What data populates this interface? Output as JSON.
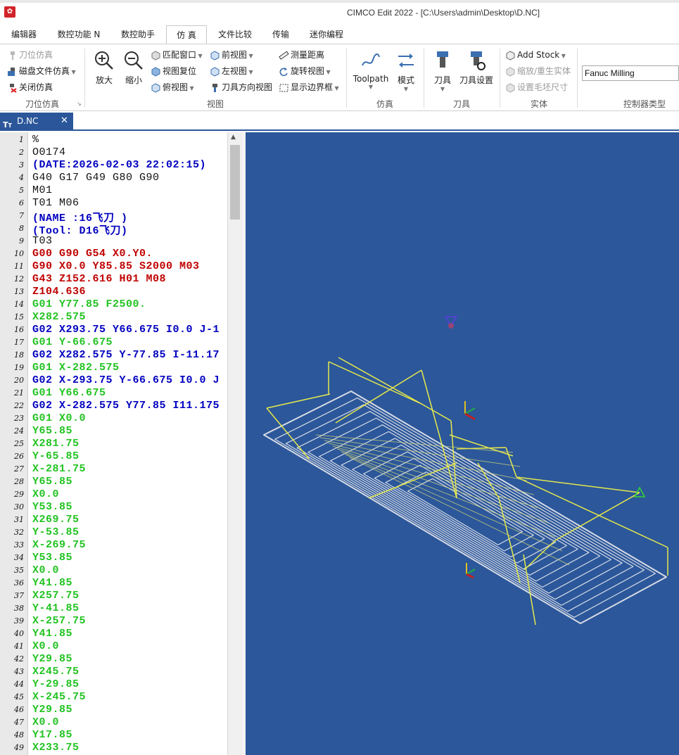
{
  "window": {
    "title": "CIMCO Edit 2022 - [C:\\Users\\admin\\Desktop\\D.NC]"
  },
  "menu": {
    "tabs": [
      {
        "label": "编辑器"
      },
      {
        "label": "数控功能 N"
      },
      {
        "label": "数控助手"
      },
      {
        "label": "仿 真"
      },
      {
        "label": "文件比较"
      },
      {
        "label": "传输"
      },
      {
        "label": "迷你编程"
      }
    ],
    "active_tab": "仿 真"
  },
  "ribbon": {
    "toolpath_sim": {
      "group_label": "刀位仿真",
      "items": [
        {
          "label": "刀位仿真",
          "icon": "tool-sim-icon",
          "enabled": false
        },
        {
          "label": "磁盘文件仿真",
          "icon": "disk-sim-icon",
          "enabled": true
        },
        {
          "label": "关闭仿真",
          "icon": "close-sim-icon",
          "enabled": true
        }
      ]
    },
    "view": {
      "group_label": "视图",
      "zoom_in": "放大",
      "zoom_out": "缩小",
      "items": [
        {
          "label": "匹配窗口",
          "icon": "fit-window-icon"
        },
        {
          "label": "视图复位",
          "icon": "view-reset-icon"
        },
        {
          "label": "俯视图",
          "icon": "top-view-icon"
        },
        {
          "label": "前视图",
          "icon": "front-view-icon"
        },
        {
          "label": "左视图",
          "icon": "left-view-icon"
        },
        {
          "label": "刀具方向视图",
          "icon": "tool-dir-view-icon"
        },
        {
          "label": "测量距离",
          "icon": "measure-icon"
        },
        {
          "label": "旋转视图",
          "icon": "rotate-view-icon"
        },
        {
          "label": "显示边界框",
          "icon": "bounding-box-icon"
        }
      ]
    },
    "simulation": {
      "group_label": "仿真",
      "toolpath": "Toolpath",
      "mode": "模式"
    },
    "tool": {
      "group_label": "刀具",
      "tool": "刀具",
      "tool_settings": "刀具设置"
    },
    "solid": {
      "group_label": "实体",
      "items": [
        {
          "label": "Add Stock",
          "enabled": true
        },
        {
          "label": "缩放/重生实体",
          "enabled": false
        },
        {
          "label": "设置毛坯尺寸",
          "enabled": false
        }
      ]
    },
    "controller": {
      "group_label": "控制器类型",
      "value": "Fanuc Milling"
    }
  },
  "document_tab": {
    "label": "D.NC"
  },
  "colors": {
    "accent": "#2b579a",
    "viewport_bg": "#2c579a",
    "code_black": "#111111",
    "code_blue": "#0000c0",
    "code_red": "#c00000",
    "code_green": "#22c322",
    "toolpath_yellow": "#e5e84c",
    "stock_outline": "#d6dbe6"
  },
  "code_lines": [
    {
      "n": "1",
      "text": "%",
      "color": "black"
    },
    {
      "n": "2",
      "text": "O0174",
      "color": "black"
    },
    {
      "n": "3",
      "text": "(DATE:2026-02-03 22:02:15)",
      "color": "blue"
    },
    {
      "n": "4",
      "text": "G40 G17 G49 G80 G90",
      "color": "black"
    },
    {
      "n": "5",
      "text": "M01",
      "color": "black"
    },
    {
      "n": "6",
      "text": "T01 M06",
      "color": "black"
    },
    {
      "n": "7",
      "text": "(NAME :16飞刀 )",
      "color": "blue"
    },
    {
      "n": "8",
      "text": "(Tool: D16飞刀)",
      "color": "blue"
    },
    {
      "n": "9",
      "text": "T03",
      "color": "black"
    },
    {
      "n": "10",
      "text": "G00 G90 G54 X0.Y0.",
      "color": "red"
    },
    {
      "n": "11",
      "text": "G90 X0.0 Y85.85 S2000 M03",
      "color": "red"
    },
    {
      "n": "12",
      "text": "G43 Z152.616 H01 M08",
      "color": "red"
    },
    {
      "n": "13",
      "text": "Z104.636",
      "color": "red"
    },
    {
      "n": "14",
      "text": "G01 Y77.85 F2500.",
      "color": "green"
    },
    {
      "n": "15",
      "text": "X282.575",
      "color": "green"
    },
    {
      "n": "16",
      "text": "G02 X293.75 Y66.675 I0.0 J-1",
      "color": "blue"
    },
    {
      "n": "17",
      "text": "G01 Y-66.675",
      "color": "green"
    },
    {
      "n": "18",
      "text": "G02 X282.575 Y-77.85 I-11.17",
      "color": "blue"
    },
    {
      "n": "19",
      "text": "G01 X-282.575",
      "color": "green"
    },
    {
      "n": "20",
      "text": "G02 X-293.75 Y-66.675 I0.0 J",
      "color": "blue"
    },
    {
      "n": "21",
      "text": "G01 Y66.675",
      "color": "green"
    },
    {
      "n": "22",
      "text": "G02 X-282.575 Y77.85 I11.175",
      "color": "blue"
    },
    {
      "n": "23",
      "text": "G01 X0.0",
      "color": "green"
    },
    {
      "n": "24",
      "text": "Y65.85",
      "color": "green"
    },
    {
      "n": "25",
      "text": "X281.75",
      "color": "green"
    },
    {
      "n": "26",
      "text": "Y-65.85",
      "color": "green"
    },
    {
      "n": "27",
      "text": "X-281.75",
      "color": "green"
    },
    {
      "n": "28",
      "text": "Y65.85",
      "color": "green"
    },
    {
      "n": "29",
      "text": "X0.0",
      "color": "green"
    },
    {
      "n": "30",
      "text": "Y53.85",
      "color": "green"
    },
    {
      "n": "31",
      "text": "X269.75",
      "color": "green"
    },
    {
      "n": "32",
      "text": "Y-53.85",
      "color": "green"
    },
    {
      "n": "33",
      "text": "X-269.75",
      "color": "green"
    },
    {
      "n": "34",
      "text": "Y53.85",
      "color": "green"
    },
    {
      "n": "35",
      "text": "X0.0",
      "color": "green"
    },
    {
      "n": "36",
      "text": "Y41.85",
      "color": "green"
    },
    {
      "n": "37",
      "text": "X257.75",
      "color": "green"
    },
    {
      "n": "38",
      "text": "Y-41.85",
      "color": "green"
    },
    {
      "n": "39",
      "text": "X-257.75",
      "color": "green"
    },
    {
      "n": "40",
      "text": "Y41.85",
      "color": "green"
    },
    {
      "n": "41",
      "text": "X0.0",
      "color": "green"
    },
    {
      "n": "42",
      "text": "Y29.85",
      "color": "green"
    },
    {
      "n": "43",
      "text": "X245.75",
      "color": "green"
    },
    {
      "n": "44",
      "text": "Y-29.85",
      "color": "green"
    },
    {
      "n": "45",
      "text": "X-245.75",
      "color": "green"
    },
    {
      "n": "46",
      "text": "Y29.85",
      "color": "green"
    },
    {
      "n": "47",
      "text": "X0.0",
      "color": "green"
    },
    {
      "n": "48",
      "text": "Y17.85",
      "color": "green"
    },
    {
      "n": "49",
      "text": "X233.75",
      "color": "green"
    }
  ]
}
